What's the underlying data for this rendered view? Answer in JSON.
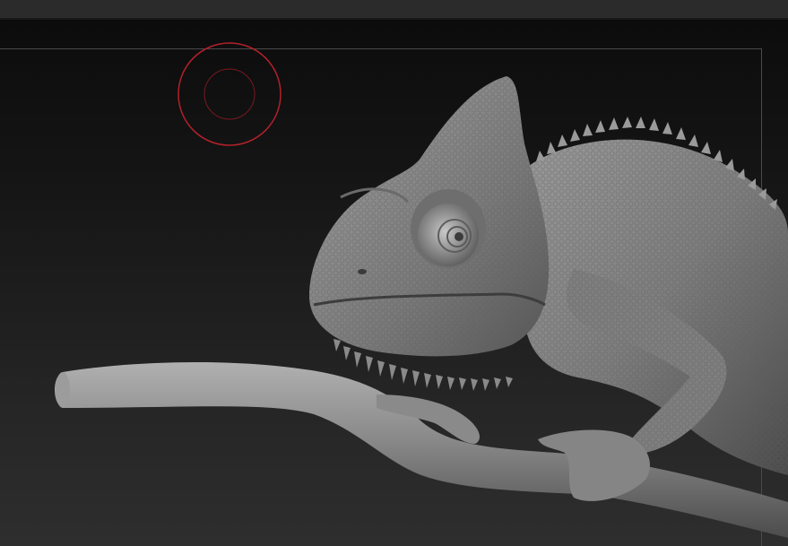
{
  "app": {
    "type": "3d-sculpting-viewport"
  },
  "viewport": {
    "subject": "chameleon-on-branch",
    "material_color": "#8d8d8d",
    "background_top": "#0c0c0c",
    "background_bottom": "#2e2e2e"
  },
  "brush_cursor": {
    "color": "#b3212b"
  }
}
